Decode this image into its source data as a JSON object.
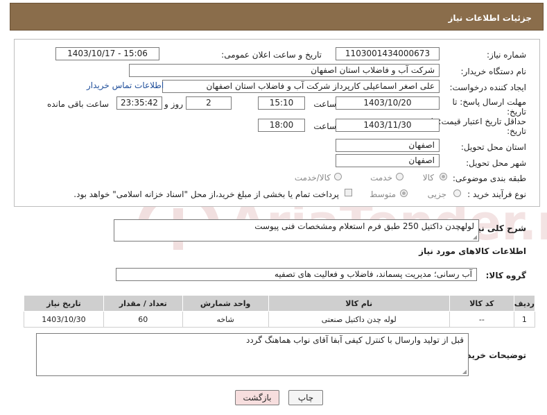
{
  "header": {
    "title": "جزئیات اطلاعات نیاز"
  },
  "form": {
    "need_number_label": "شماره نیاز:",
    "need_number": "1103001434000673",
    "announce_label": "تاریخ و ساعت اعلان عمومی:",
    "announce_value": "1403/10/17 - 15:06",
    "buyer_label": "نام دستگاه خریدار:",
    "buyer_value": "شرکت آب و فاضلاب استان اصفهان",
    "creator_label": "ایجاد کننده درخواست:",
    "creator_value": "علی اصغر اسماعیلی کارپرداز شرکت آب و فاضلاب استان اصفهان",
    "contact_link": "اطلاعات تماس خریدار",
    "deadline_label_1": "مهلت ارسال پاسخ: تا",
    "deadline_label_2": "تاریخ:",
    "deadline_date": "1403/10/20",
    "time_label": "ساعت",
    "deadline_time": "15:10",
    "days_value": "2",
    "days_label": "روز و",
    "remaining_time": "23:35:42",
    "remaining_label": "ساعت باقی مانده",
    "validity_label_1": "حداقل تاریخ اعتبار قیمت: تا",
    "validity_label_2": "تاریخ:",
    "validity_date": "1403/11/30",
    "validity_time": "18:00",
    "province_label": "استان محل تحویل:",
    "province_value": "اصفهان",
    "city_label": "شهر محل تحویل:",
    "city_value": "اصفهان",
    "category_label": "طبقه بندی موضوعی:",
    "category_options": [
      "کالا",
      "خدمت",
      "کالا/خدمت"
    ],
    "process_label": "نوع فرآیند خرید :",
    "process_options": [
      "جزیی",
      "متوسط"
    ],
    "payment_note": "پرداخت تمام یا بخشی از مبلغ خرید،از محل \"اسناد خزانه اسلامی\" خواهد بود."
  },
  "description": {
    "label": "شرح کلی نیاز:",
    "value": "لولهچدن داکتیل 250 طبق فرم استعلام ومشخصات فنی پیوست"
  },
  "goods_section": {
    "title": "اطلاعات کالاهای مورد نیاز",
    "group_label": "گروه کالا:",
    "group_value": "آب رسانی؛ مدیریت پسماند، فاضلاب و فعالیت های تصفیه"
  },
  "table": {
    "headers": [
      "ردیف",
      "کد کالا",
      "نام کالا",
      "واحد شمارش",
      "تعداد / مقدار",
      "تاریخ نیاز"
    ],
    "rows": [
      [
        "1",
        "--",
        "لوله چدن داکتیل صنعتی",
        "شاخه",
        "60",
        "1403/10/30"
      ]
    ]
  },
  "buyer_notes": {
    "label": "توضیحات خریدار:",
    "value": "قبل از تولید وارسال با کنترل کیفی آبفا آقای نواب هماهنگ گردد"
  },
  "buttons": {
    "print": "چاپ",
    "back": "بازگشت"
  },
  "colors": {
    "header_bg": "#8a6d4b",
    "back_button_bg": "#f7dede",
    "table_header_bg": "#cfcfcf"
  },
  "watermark": {
    "text": "AriaTender.neT"
  }
}
